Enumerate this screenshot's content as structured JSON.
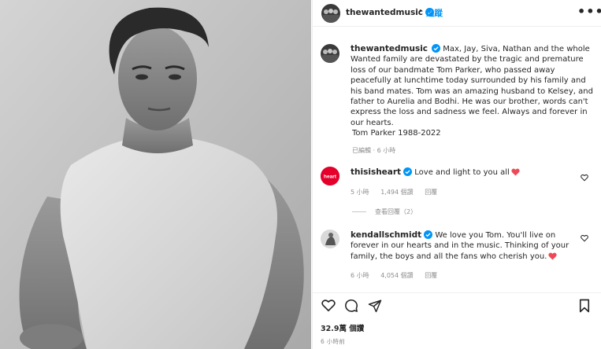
{
  "post": {
    "username": "thewantedmusic",
    "follow_separator": "•",
    "follow_label": "追蹤",
    "more_label": "•••"
  },
  "caption": {
    "username": "thewantedmusic",
    "text": "Max, Jay, Siva, Nathan and the whole Wanted family are devastated by the tragic and premature loss of our bandmate Tom Parker, who passed away peacefully at lunchtime today surrounded by his family and his band mates. Tom was an amazing husband to Kelsey, and father to Aurelia and Bodhi. He was our brother, words can't express the loss and sadness we feel. Always and forever in our hearts.",
    "tom_line": "Tom Parker 1988-2022",
    "edited": "已編輯 · 6 小時"
  },
  "comments": [
    {
      "username": "thisisheart",
      "avatar_label": "heart",
      "text": "Love and light to you all",
      "time": "5 小時",
      "likes": "1,494 個讚",
      "reply": "回覆"
    },
    {
      "username": "kendallschmidt",
      "text": "We love you Tom. You'll live on forever in our hearts and in the music. Thinking of your family, the boys and all the fans who cherish you.",
      "time": "6 小時",
      "likes": "4,054 個讚",
      "reply": "回覆"
    }
  ],
  "view_replies": "查看回覆（2）",
  "footer": {
    "likes": "32.9萬 個讚",
    "time_ago": "6 小時前"
  },
  "colors": {
    "accent": "#0095f6",
    "heart_red": "#ed4956",
    "heart_brand": "#e4002b",
    "text": "#262626",
    "muted": "#8e8e8e"
  },
  "icons": [
    "verified-badge-icon",
    "more-options-icon",
    "heart-icon",
    "comment-icon",
    "share-icon",
    "bookmark-icon",
    "red-heart-emoji-icon"
  ]
}
